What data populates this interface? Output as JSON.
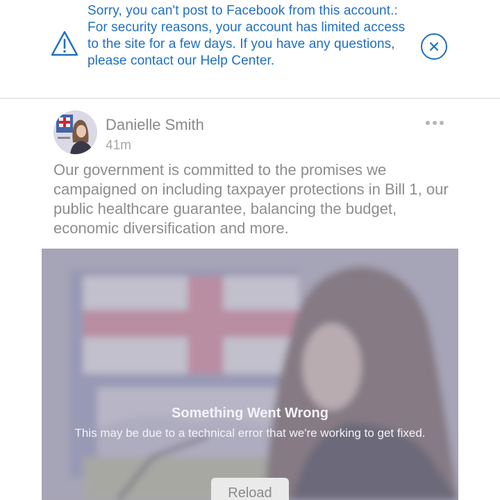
{
  "banner": {
    "message": "Sorry, you can't post to Facebook from this account.: For security reasons, your account has limited access to the site for a few days. If you have any questions, please contact our Help Center.",
    "accent_color": "#1f6fc2",
    "icons": {
      "warning": "warning-triangle-icon",
      "close": "close-circle-icon"
    }
  },
  "post": {
    "author": "Danielle Smith",
    "timestamp": "41m",
    "text": "Our government is committed to the promises we campaigned on including taxpayer protections in Bill 1, our public healthcare guarantee, balancing the budget, economic diversification and more.",
    "icons": {
      "more": "more-dots-icon"
    }
  },
  "media_error": {
    "title": "Something Went Wrong",
    "message": "This may be due to a technical error that we're working to get fixed.",
    "reload_label": "Reload"
  }
}
